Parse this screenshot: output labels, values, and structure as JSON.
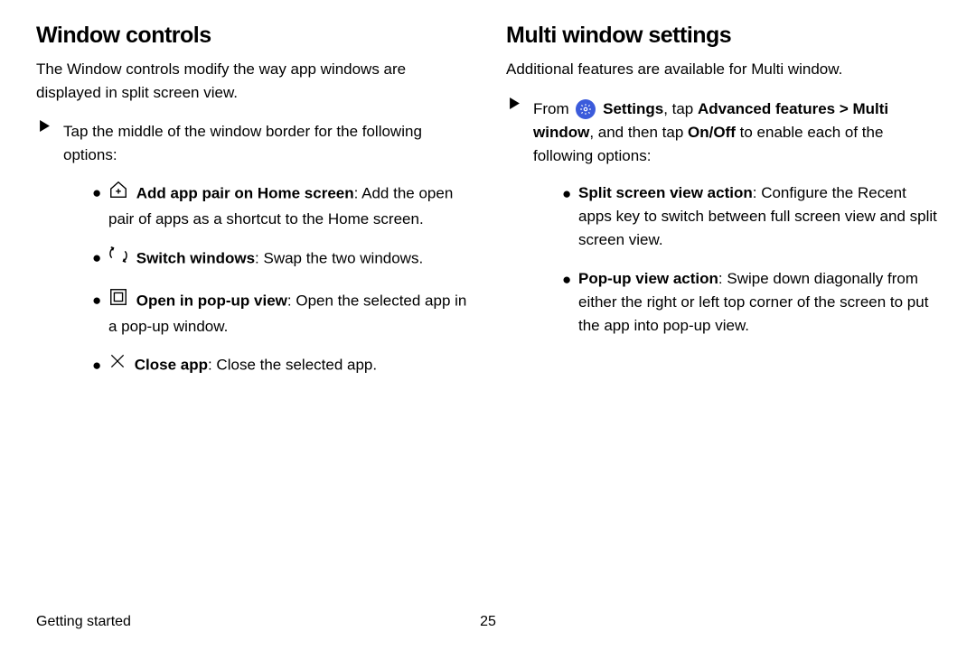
{
  "left": {
    "heading": "Window controls",
    "intro": "The Window controls modify the way app windows are displayed in split screen view.",
    "outer_text": "Tap the middle of the window border for the following options:",
    "items": {
      "add_pair_bold": "Add app pair on Home screen",
      "add_pair_rest": ": Add the open pair of apps as a shortcut to the Home screen.",
      "switch_bold": "Switch windows",
      "switch_rest": ": Swap the two windows.",
      "popup_bold": "Open in pop-up view",
      "popup_rest": ": Open the selected app in a pop-up window.",
      "close_bold": "Close app",
      "close_rest": ": Close the selected app."
    }
  },
  "right": {
    "heading": "Multi window settings",
    "intro": "Additional features are available for Multi window.",
    "step_from": "From ",
    "step_settings": " Settings",
    "step_tap": ", tap ",
    "step_adv": "Advanced features",
    "step_gt": " > ",
    "step_multi": "Multi window",
    "step_and": ", and then tap ",
    "step_onoff": "On/Off",
    "step_enable": " to enable each of the following options:",
    "items": {
      "split_bold": "Split screen view action",
      "split_rest": ": Configure the Recent apps key to switch between full screen view and split screen view.",
      "popup_bold": "Pop-up view action",
      "popup_rest": ": Swipe down diagonally from either the right or left top corner of the screen to put the app into pop-up view."
    }
  },
  "footer": {
    "section": "Getting started",
    "page": "25"
  }
}
